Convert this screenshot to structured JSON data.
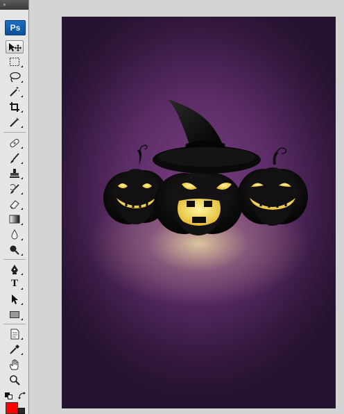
{
  "app": {
    "logo_text": "Ps",
    "panel_collapse_glyph": "»",
    "active_tool": "move-tool"
  },
  "toolbox": {
    "tools": [
      {
        "name": "move-tool",
        "icon": "move-icon"
      },
      {
        "name": "rectangular-marquee-tool",
        "icon": "marquee-icon"
      },
      {
        "name": "lasso-tool",
        "icon": "lasso-icon"
      },
      {
        "name": "magic-wand-tool",
        "icon": "magic-wand-icon"
      },
      {
        "name": "crop-tool",
        "icon": "crop-icon"
      },
      {
        "name": "eyedropper-slice-tool",
        "icon": "slice-icon"
      },
      {
        "name": "healing-brush-tool",
        "icon": "bandage-icon"
      },
      {
        "name": "brush-tool",
        "icon": "brush-icon"
      },
      {
        "name": "clone-stamp-tool",
        "icon": "stamp-icon"
      },
      {
        "name": "history-brush-tool",
        "icon": "history-brush-icon"
      },
      {
        "name": "eraser-tool",
        "icon": "eraser-icon"
      },
      {
        "name": "gradient-tool",
        "icon": "gradient-icon"
      },
      {
        "name": "blur-tool",
        "icon": "blur-drop-icon"
      },
      {
        "name": "dodge-tool",
        "icon": "dodge-icon"
      },
      {
        "name": "pen-tool",
        "icon": "pen-icon"
      },
      {
        "name": "type-tool",
        "icon": "type-icon",
        "glyph": "T"
      },
      {
        "name": "path-selection-tool",
        "icon": "arrow-icon"
      },
      {
        "name": "rectangle-shape-tool",
        "icon": "rectangle-icon"
      },
      {
        "name": "notes-tool",
        "icon": "note-icon"
      },
      {
        "name": "eyedropper-tool",
        "icon": "eyedropper-icon"
      },
      {
        "name": "hand-tool",
        "icon": "hand-icon"
      },
      {
        "name": "zoom-tool",
        "icon": "zoom-icon"
      }
    ],
    "colors": {
      "foreground": "#ff0000",
      "background": "#2a2a2a"
    }
  },
  "document": {
    "artwork": "three-pumpkins-witch-hat",
    "colors": {
      "background_center": "#7a3f80",
      "background_edge": "#241230",
      "glow": "#eeddA5",
      "pumpkin": "#0b0b0b",
      "face": "#f2d23a"
    }
  }
}
